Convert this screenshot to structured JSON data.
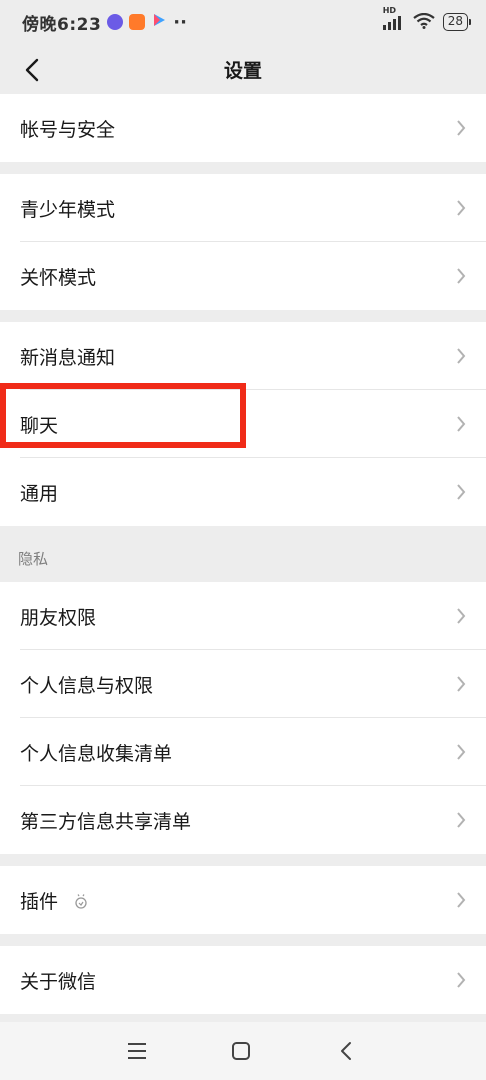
{
  "status_bar": {
    "time": "傍晚6:23",
    "more": "··",
    "network": "HD",
    "battery": "28",
    "app_colors": [
      "#6b5be6",
      "#ff7a2a",
      "#3fa2ff"
    ]
  },
  "header": {
    "title": "设置",
    "back_icon": "chevron-left-icon"
  },
  "groups": [
    {
      "items": [
        {
          "label": "帐号与安全"
        }
      ]
    },
    {
      "items": [
        {
          "label": "青少年模式"
        },
        {
          "label": "关怀模式"
        }
      ]
    },
    {
      "items": [
        {
          "label": "新消息通知"
        },
        {
          "label": "聊天"
        },
        {
          "label": "通用"
        }
      ]
    },
    {
      "title": "隐私",
      "items": [
        {
          "label": "朋友权限"
        },
        {
          "label": "个人信息与权限"
        },
        {
          "label": "个人信息收集清单"
        },
        {
          "label": "第三方信息共享清单"
        }
      ]
    },
    {
      "items": [
        {
          "label": "插件"
        }
      ]
    },
    {
      "items": [
        {
          "label": "关于微信"
        }
      ]
    }
  ],
  "colors": {
    "highlight": "#f02b18",
    "background": "#ededed"
  },
  "system_nav": [
    "menu-icon",
    "home-icon",
    "back-icon"
  ]
}
